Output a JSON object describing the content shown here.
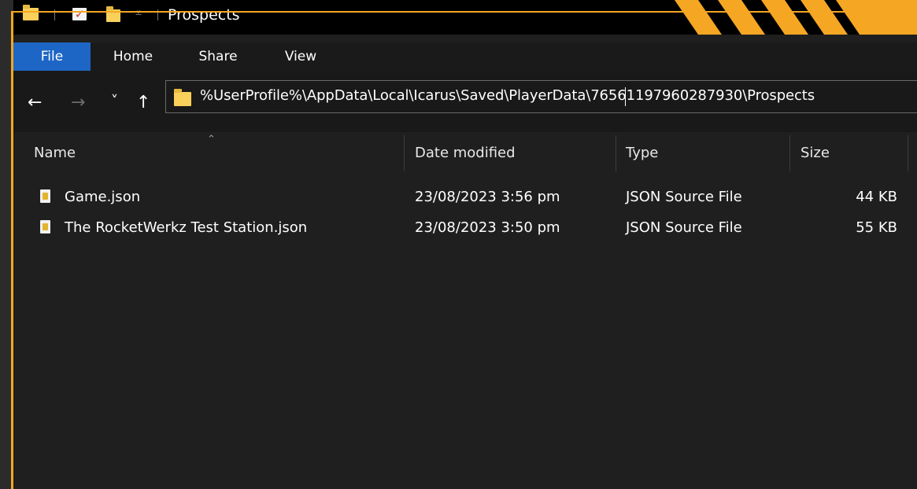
{
  "window": {
    "title": "Prospects"
  },
  "ribbon": {
    "tabs": [
      {
        "label": "File",
        "active": true
      },
      {
        "label": "Home",
        "active": false
      },
      {
        "label": "Share",
        "active": false
      },
      {
        "label": "View",
        "active": false
      }
    ]
  },
  "nav": {
    "back_icon": "arrow-left-icon",
    "forward_icon": "arrow-right-icon",
    "recent_icon": "chevron-down-icon",
    "up_icon": "arrow-up-icon",
    "back_glyph": "←",
    "forward_glyph": "→",
    "recent_glyph": "˅",
    "up_glyph": "↑",
    "address_path": "%UserProfile%\\AppData\\Local\\Icarus\\Saved\\PlayerData\\76561197960287930\\Prospects"
  },
  "columns": {
    "name": "Name",
    "date": "Date modified",
    "type": "Type",
    "size": "Size"
  },
  "files": [
    {
      "name": "Game.json",
      "date": "23/08/2023 3:56 pm",
      "type": "JSON Source File",
      "size": "44 KB"
    },
    {
      "name": "The RocketWerkz Test Station.json",
      "date": "23/08/2023 3:50 pm",
      "type": "JSON Source File",
      "size": "55 KB"
    }
  ],
  "colors": {
    "accent": "#f5a623",
    "file_tab": "#1e66c5",
    "background": "#1f1f1f",
    "folder": "#f8d05a"
  }
}
